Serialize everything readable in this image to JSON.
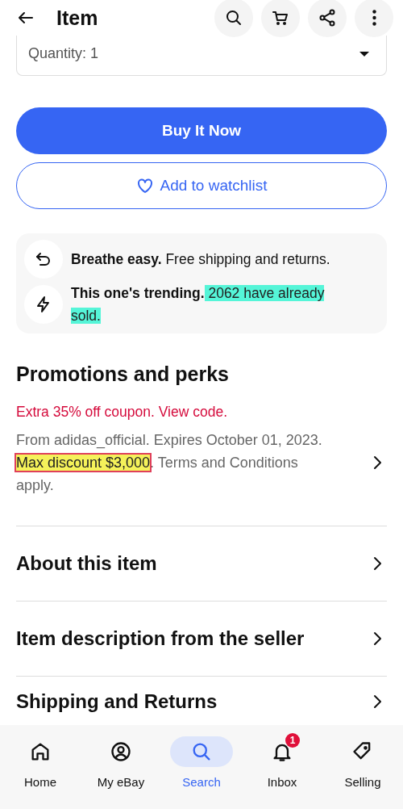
{
  "header": {
    "title": "Item",
    "actions": [
      {
        "kind": "search"
      },
      {
        "kind": "cart"
      },
      {
        "kind": "share"
      },
      {
        "kind": "more"
      }
    ]
  },
  "quantity": {
    "value": "Quantity: 1"
  },
  "buttons": [
    {
      "kind": "primary",
      "label": "Buy It Now"
    },
    {
      "kind": "watch",
      "label": "Add to watchlist"
    }
  ],
  "perks": [
    {
      "kind": "returns",
      "parts": [
        {
          "text": "Breathe easy.",
          "bold": true
        },
        {
          "text": " Free shipping and returns."
        }
      ]
    },
    {
      "kind": "trending",
      "parts": [
        {
          "text": "This one's trending.",
          "bold": true
        },
        {
          "text": " 2062 have already sold.",
          "color": "#55f5d8"
        }
      ]
    }
  ],
  "promotions": {
    "title": "Promotions and perks",
    "coupon": "Extra 35% off coupon. View code.",
    "details": [
      {
        "text": "From adidas_official. Expires October 01, 2023. "
      },
      {
        "text": "Max discount $3,000",
        "color": "#f5f25a",
        "boxed": true
      },
      {
        "text": ". Terms and Conditions apply."
      }
    ]
  },
  "sections": [
    {
      "title": "About this item"
    },
    {
      "title": "Item description from the seller"
    },
    {
      "title": "Shipping and Returns"
    }
  ],
  "nav": [
    {
      "kind": "home",
      "label": "Home",
      "selected": false
    },
    {
      "kind": "account",
      "label": "My eBay",
      "selected": false
    },
    {
      "kind": "search",
      "label": "Search",
      "selected": true
    },
    {
      "kind": "bell",
      "label": "Inbox",
      "selected": false,
      "badge": "1"
    },
    {
      "kind": "tag",
      "label": "Selling",
      "selected": false
    }
  ]
}
